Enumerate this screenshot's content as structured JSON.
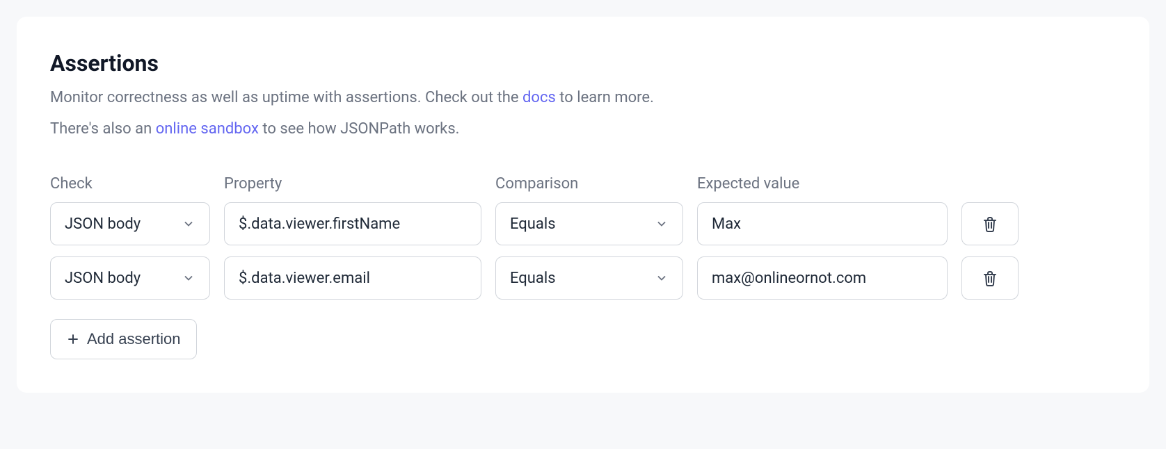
{
  "section": {
    "title": "Assertions",
    "description_parts": {
      "line1_pre": "Monitor correctness as well as uptime with assertions. Check out the ",
      "line1_link": "docs",
      "line1_post": " to learn more.",
      "line2_pre": "There's also an ",
      "line2_link": "online sandbox",
      "line2_post": " to see how JSONPath works."
    }
  },
  "columns": {
    "check": "Check",
    "property": "Property",
    "comparison": "Comparison",
    "expected": "Expected value"
  },
  "rows": [
    {
      "check": "JSON body",
      "property": "$.data.viewer.firstName",
      "comparison": "Equals",
      "expected": "Max"
    },
    {
      "check": "JSON body",
      "property": "$.data.viewer.email",
      "comparison": "Equals",
      "expected": "max@onlineornot.com"
    }
  ],
  "buttons": {
    "add_assertion": "Add assertion"
  }
}
